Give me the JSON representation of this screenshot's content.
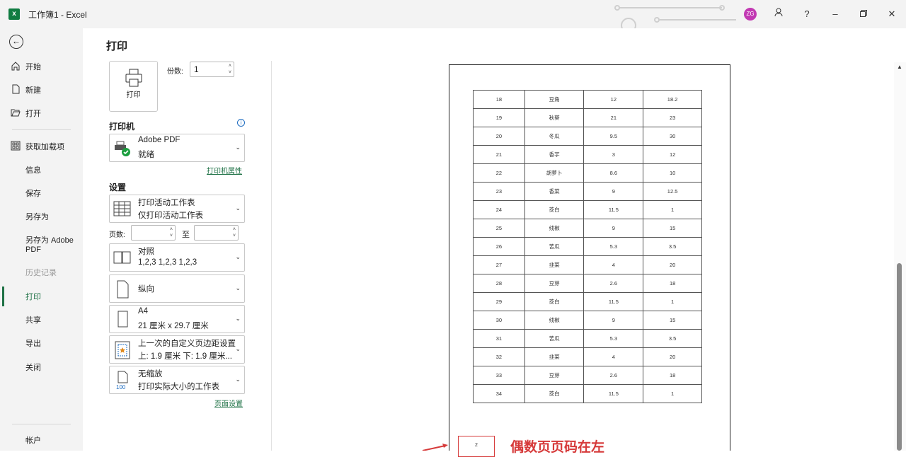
{
  "window": {
    "title": "工作簿1 - Excel",
    "avatar_initials": "ZG",
    "help_label": "?",
    "accent_color": "#1e7145"
  },
  "nav": {
    "back_icon": "back-arrow-icon",
    "items": [
      {
        "label": "开始",
        "icon": "home-icon"
      },
      {
        "label": "新建",
        "icon": "new-document-icon"
      },
      {
        "label": "打开",
        "icon": "open-folder-icon"
      },
      {
        "label": "获取加载项",
        "icon": "add-ins-grid-icon"
      },
      {
        "label": "信息"
      },
      {
        "label": "保存"
      },
      {
        "label": "另存为"
      },
      {
        "label": "另存为 Adobe PDF"
      },
      {
        "label": "历史记录",
        "disabled": true
      },
      {
        "label": "打印",
        "active": true
      },
      {
        "label": "共享"
      },
      {
        "label": "导出"
      },
      {
        "label": "关闭"
      }
    ],
    "account_label": "帐户"
  },
  "print": {
    "page_title": "打印",
    "print_button_label": "打印",
    "copies_label": "份数:",
    "copies_value": "1",
    "printer_section": "打印机",
    "printer_name": "Adobe PDF",
    "printer_status": "就绪",
    "printer_properties_link": "打印机属性",
    "settings_section": "设置",
    "scope_title": "打印活动工作表",
    "scope_desc": "仅打印活动工作表",
    "pages_label": "页数:",
    "pages_to_label": "至",
    "collate_title": "对照",
    "collate_desc": "1,2,3    1,2,3    1,2,3",
    "orientation": "纵向",
    "paper_title": "A4",
    "paper_desc": "21 厘米 x 29.7 厘米",
    "margins_title": "上一次的自定义页边距设置",
    "margins_desc": "上: 1.9 厘米 下: 1.9 厘米...",
    "scaling_title": "无缩放",
    "scaling_desc": "打印实际大小的工作表",
    "page_setup_link": "页面设置"
  },
  "preview": {
    "rows": [
      [
        "18",
        "豆角",
        "12",
        "18.2"
      ],
      [
        "19",
        "秋葵",
        "21",
        "23"
      ],
      [
        "20",
        "冬瓜",
        "9.5",
        "30"
      ],
      [
        "21",
        "香芋",
        "3",
        "12"
      ],
      [
        "22",
        "胡萝卜",
        "8.6",
        "10"
      ],
      [
        "23",
        "香菜",
        "9",
        "12.5"
      ],
      [
        "24",
        "茭白",
        "11.5",
        "1"
      ],
      [
        "25",
        "线椒",
        "9",
        "15"
      ],
      [
        "26",
        "苦瓜",
        "5.3",
        "3.5"
      ],
      [
        "27",
        "韭菜",
        "4",
        "20"
      ],
      [
        "28",
        "豆芽",
        "2.6",
        "18"
      ],
      [
        "29",
        "茭白",
        "11.5",
        "1"
      ],
      [
        "30",
        "线椒",
        "9",
        "15"
      ],
      [
        "31",
        "苦瓜",
        "5.3",
        "3.5"
      ],
      [
        "32",
        "韭菜",
        "4",
        "20"
      ],
      [
        "33",
        "豆芽",
        "2.6",
        "18"
      ],
      [
        "34",
        "茭白",
        "11.5",
        "1"
      ]
    ],
    "page_number": "2",
    "annotation": "偶数页页码在左",
    "annotation_color": "#d63a3a"
  }
}
